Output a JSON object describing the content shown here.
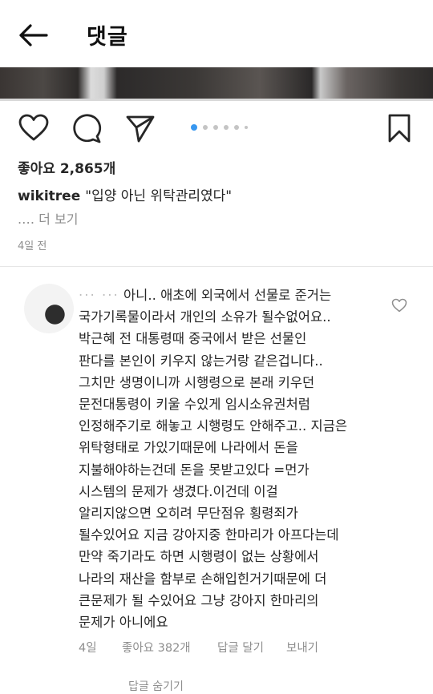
{
  "header": {
    "title": "댓글"
  },
  "post": {
    "likes": "좋아요 2,865개",
    "username": "wikitree",
    "caption": "\"입양 아닌 위탁관리였다\"",
    "more": ".… 더 보기",
    "time": "4일 전",
    "carousel": {
      "count": 6,
      "active_index": 0
    }
  },
  "comment": {
    "redacted_prefix": "··· ···",
    "lines": [
      "아니.. 애초에 외국에서 선물로 준거는",
      "국가기록물이라서 개인의 소유가 될수없어요..",
      "박근혜 전 대통령때 중국에서 받은 선물인",
      "판다를 본인이 키우지 않는거랑 같은겁니다..",
      "그치만 생명이니까 시행령으로 본래 키우던",
      "문전대통령이 키울 수있게 임시소유권처럼",
      "인정해주기로 해놓고 시행령도 안해주고.. 지금은",
      "위탁형태로 가있기때문에 나라에서 돈을",
      "지불해야하는건데 돈을 못받고있다 =먼가",
      "시스템의 문제가 생겼다.이건데  이걸",
      "알리지않으면 오히려 무단점유 횡령죄가",
      "될수있어요 지금 강아지중 한마리가 아프다는데",
      "만약 죽기라도 하면 시행령이 없는 상황에서",
      "나라의 재산을 함부로 손해입힌거기때문에 더",
      "큰문제가 될 수있어요 그냥 강아지 한마리의",
      "문제가 아니에요"
    ],
    "time": "4일",
    "likes": "좋아요 382개",
    "reply": "답글 달기",
    "send": "보내기",
    "view_replies": "답글 숨기기"
  },
  "colors": {
    "accent": "#3897f0",
    "muted": "#8e8e8e",
    "text": "#262626"
  },
  "icons": [
    "back-arrow-icon",
    "heart-icon",
    "comment-icon",
    "send-icon",
    "bookmark-icon",
    "small-heart-icon"
  ]
}
